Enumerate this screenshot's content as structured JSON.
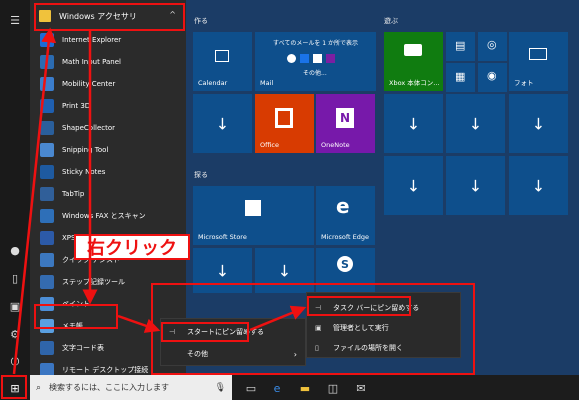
{
  "folder": {
    "label": "Windows アクセサリ",
    "chevron": "^"
  },
  "apps": [
    "Internet Explorer",
    "Math Input Panel",
    "Mobility Center",
    "Print 3D",
    "ShapeCollector",
    "Snipping Tool",
    "Sticky Notes",
    "TabTip",
    "Windows FAX とスキャン",
    "XPS ビューアー",
    "クイック アシスト",
    "ステップ記録ツール",
    "ペイント",
    "メモ帳",
    "文字コード表",
    "リモート デスクトップ接続"
  ],
  "groups": {
    "create": "作る",
    "play": "遊ぶ",
    "explore": "探る"
  },
  "tiles": {
    "calendar": "Calendar",
    "mail_header": "すべてのメールを 1 か所で表示",
    "mail_other": "その他...",
    "mail": "Mail",
    "office": "Office",
    "onenote": "OneNote",
    "xbox": "Xbox 本体コン...",
    "photos": "フォト",
    "store": "Microsoft Store",
    "edge": "Microsoft Edge"
  },
  "callout": "右クリック",
  "menu1": {
    "pin_start": "スタートにピン留めする",
    "more": "その他"
  },
  "menu2": {
    "pin_taskbar": "タスク バーにピン留めする",
    "run_admin": "管理者として実行",
    "open_location": "ファイルの場所を開く"
  },
  "taskbar": {
    "search_placeholder": "検索するには、ここに入力します"
  },
  "colors": {
    "annotation": "#e11111",
    "tile": "#0e4f8c",
    "office": "#d83b01",
    "onenote": "#7719aa",
    "xbox": "#107c10"
  }
}
